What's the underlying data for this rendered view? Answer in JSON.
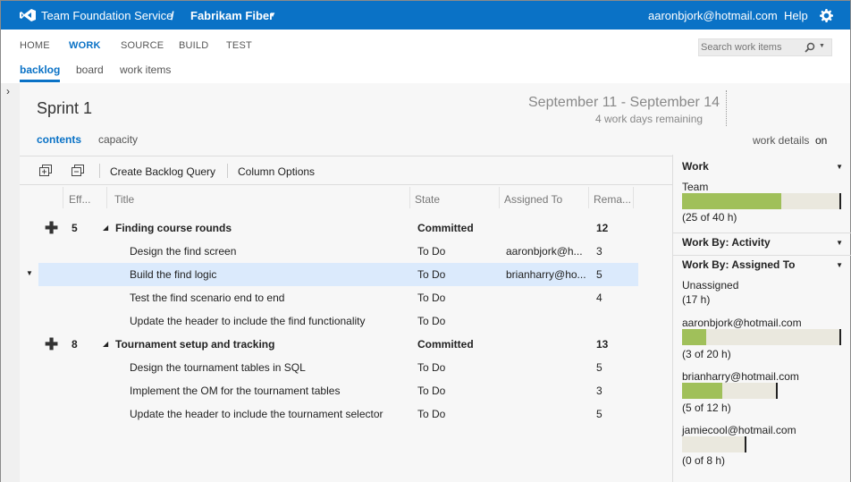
{
  "topbar": {
    "product": "Team Foundation Service",
    "separator": "/",
    "project": "Fabrikam Fiber",
    "user": "aaronbjork@hotmail.com",
    "help": "Help"
  },
  "nav": {
    "hubs": [
      "HOME",
      "WORK",
      "SOURCE",
      "BUILD",
      "TEST"
    ],
    "subtabs": [
      "backlog",
      "board",
      "work items"
    ],
    "search_placeholder": "Search work items"
  },
  "sprint": {
    "title": "Sprint 1",
    "dates": "September 11 - September 14",
    "remaining": "4 work days remaining",
    "tabs": [
      "contents",
      "capacity"
    ],
    "work_details_label": "work details",
    "work_details_state": "on"
  },
  "toolbar": {
    "create_query": "Create Backlog Query",
    "column_options": "Column Options"
  },
  "columns": [
    "Eff...",
    "Title",
    "State",
    "Assigned To",
    "Rema..."
  ],
  "rows": [
    {
      "effort": "5",
      "title": "Finding course rounds",
      "state": "Committed",
      "assigned": "",
      "remaining": "12",
      "parent": true
    },
    {
      "effort": "",
      "title": "Design the find screen",
      "state": "To Do",
      "assigned": "aaronbjork@h...",
      "remaining": "3",
      "parent": false
    },
    {
      "effort": "",
      "title": "Build the find logic",
      "state": "To Do",
      "assigned": "brianharry@ho...",
      "remaining": "5",
      "parent": false,
      "selected": true
    },
    {
      "effort": "",
      "title": "Test the find scenario end to end",
      "state": "To Do",
      "assigned": "",
      "remaining": "4",
      "parent": false
    },
    {
      "effort": "",
      "title": "Update the header to include the find functionality",
      "state": "To Do",
      "assigned": "",
      "remaining": "",
      "parent": false
    },
    {
      "effort": "8",
      "title": "Tournament setup and tracking",
      "state": "Committed",
      "assigned": "",
      "remaining": "13",
      "parent": true
    },
    {
      "effort": "",
      "title": "Design the tournament tables in SQL",
      "state": "To Do",
      "assigned": "",
      "remaining": "5",
      "parent": false
    },
    {
      "effort": "",
      "title": "Implement the OM for the tournament tables",
      "state": "To Do",
      "assigned": "",
      "remaining": "3",
      "parent": false
    },
    {
      "effort": "",
      "title": "Update the header to include the tournament selector",
      "state": "To Do",
      "assigned": "",
      "remaining": "5",
      "parent": false
    }
  ],
  "panel": {
    "work_title": "Work",
    "team_label": "Team",
    "team_text": "(25 of 40 h)",
    "team_fill": 0.625,
    "activity_title": "Work By: Activity",
    "assigned_title": "Work By: Assigned To",
    "people": [
      {
        "name": "Unassigned",
        "text": "(17 h)",
        "bar": false
      },
      {
        "name": "aaronbjork@hotmail.com",
        "text": "(3 of 20 h)",
        "bar": true,
        "fill": 0.15,
        "capacity": 1.0
      },
      {
        "name": "brianharry@hotmail.com",
        "text": "(5 of 12 h)",
        "bar": true,
        "fill": 0.42,
        "capacity": 0.6
      },
      {
        "name": "jamiecool@hotmail.com",
        "text": "(0 of 8 h)",
        "bar": true,
        "fill": 0,
        "capacity": 0.4
      }
    ]
  },
  "colors": {
    "accent": "#0a72c6",
    "bar_fill": "#a0c05a",
    "bar_bg": "#eae8de",
    "selected_row": "#dbeafc"
  }
}
